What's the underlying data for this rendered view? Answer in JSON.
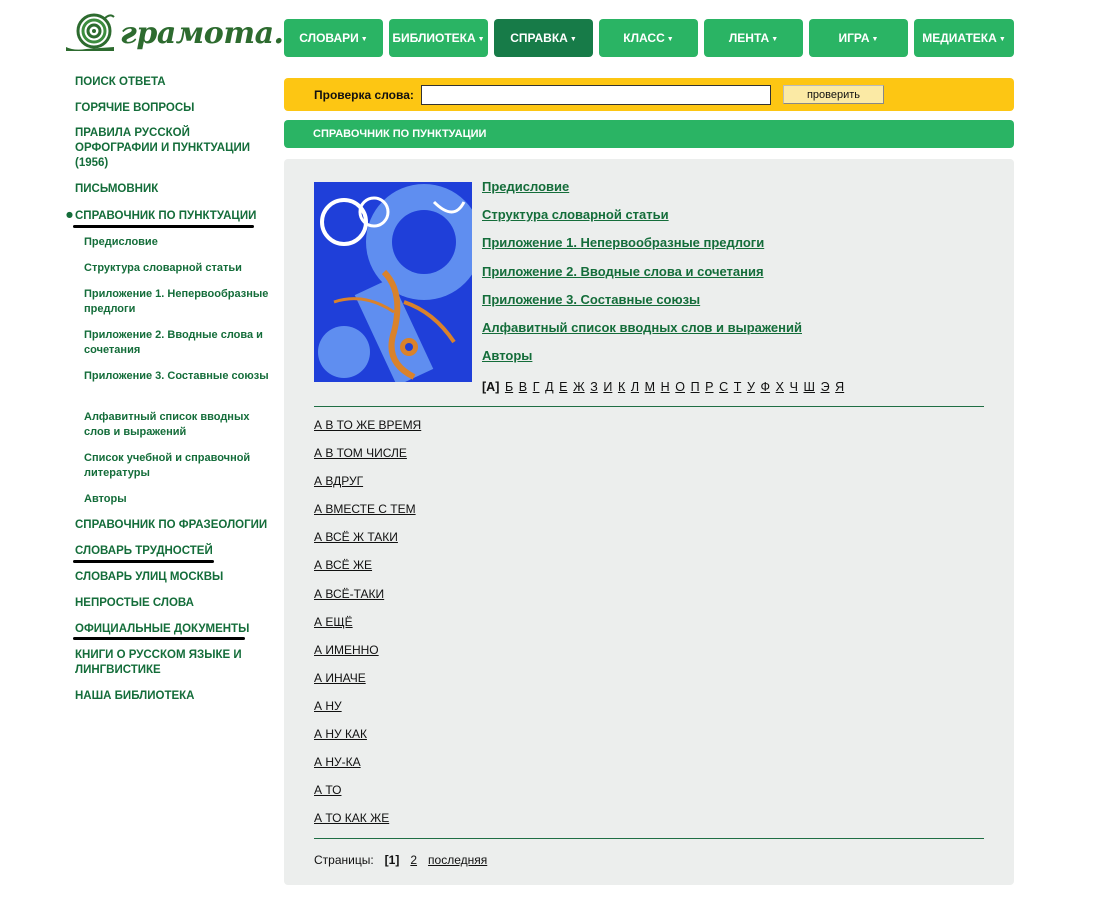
{
  "logo": {
    "text": "грамота.ру"
  },
  "nav": [
    {
      "label": "СЛОВАРИ",
      "active": false
    },
    {
      "label": "БИБЛИОТЕКА",
      "active": false
    },
    {
      "label": "СПРАВКА",
      "active": true
    },
    {
      "label": "КЛАСС",
      "active": false
    },
    {
      "label": "ЛЕНТА",
      "active": false
    },
    {
      "label": "ИГРА",
      "active": false
    },
    {
      "label": "МЕДИАТЕКА",
      "active": false
    }
  ],
  "check": {
    "label": "Проверка слова:",
    "value": "",
    "button": "проверить"
  },
  "section_title": "СПРАВОЧНИК ПО ПУНКТУАЦИИ",
  "sidebar": {
    "items": [
      {
        "label": "ПОИСК ОТВЕТА"
      },
      {
        "label": "ГОРЯЧИЕ ВОПРОСЫ"
      },
      {
        "label": "ПРАВИЛА РУССКОЙ ОРФОГРАФИИ И ПУНКТУАЦИИ (1956)"
      },
      {
        "label": "ПИСЬМОВНИК"
      },
      {
        "label": "СПРАВОЧНИК ПО ПУНКТУАЦИИ"
      },
      {
        "label": "СПРАВОЧНИК ПО ФРАЗЕОЛОГИИ"
      },
      {
        "label": "СЛОВАРЬ ТРУДНОСТЕЙ"
      },
      {
        "label": "СЛОВАРЬ УЛИЦ МОСКВЫ"
      },
      {
        "label": "НЕПРОСТЫЕ СЛОВА"
      },
      {
        "label": "ОФИЦИАЛЬНЫЕ ДОКУМЕНТЫ"
      },
      {
        "label": "КНИГИ О РУССКОМ ЯЗЫКЕ И ЛИНГВИСТИКЕ"
      },
      {
        "label": "НАША БИБЛИОТЕКА"
      }
    ],
    "subitems": [
      {
        "label": "Предисловие"
      },
      {
        "label": "Структура словарной статьи"
      },
      {
        "label": "Приложение 1. Непервообразные предлоги"
      },
      {
        "label": "Приложение 2. Вводные слова и сочетания"
      },
      {
        "label": "Приложение 3. Составные союзы"
      },
      {
        "label": "Алфавитный список вводных слов и выражений"
      },
      {
        "label": "Список учебной и справочной литературы"
      },
      {
        "label": "Авторы"
      }
    ]
  },
  "toc": [
    "Предисловие",
    "Структура словарной статьи",
    "Приложение 1. Непервообразные предлоги",
    "Приложение 2. Вводные слова и сочетания",
    "Приложение 3. Составные союзы",
    "Алфавитный список вводных слов и выражений",
    "Авторы"
  ],
  "alphabet": {
    "current": "[А]",
    "letters": [
      "Б",
      "В",
      "Г",
      "Д",
      "Е",
      "Ж",
      "З",
      "И",
      "К",
      "Л",
      "М",
      "Н",
      "О",
      "П",
      "Р",
      "С",
      "Т",
      "У",
      "Ф",
      "Х",
      "Ч",
      "Ш",
      "Э",
      "Я"
    ]
  },
  "entries": [
    "А В ТО ЖЕ ВРЕМЯ",
    "А В ТОМ ЧИСЛЕ",
    "А ВДРУГ",
    "А ВМЕСТЕ С ТЕМ",
    "А ВСЁ Ж ТАКИ",
    "А ВСЁ ЖЕ",
    "А ВСЁ-ТАКИ",
    "А ЕЩЁ",
    "А ИМЕННО",
    "А ИНАЧЕ",
    "А НУ",
    "А НУ КАК",
    "А НУ-КА",
    "А ТО",
    "А ТО КАК ЖЕ"
  ],
  "pager": {
    "label": "Страницы:",
    "current": "[1]",
    "next": "2",
    "last": "последняя"
  },
  "colors": {
    "green": "#2ab464",
    "green_active": "#177b48",
    "link_green": "#146d3a",
    "yellow": "#fdc613",
    "panel": "#eceeed"
  }
}
